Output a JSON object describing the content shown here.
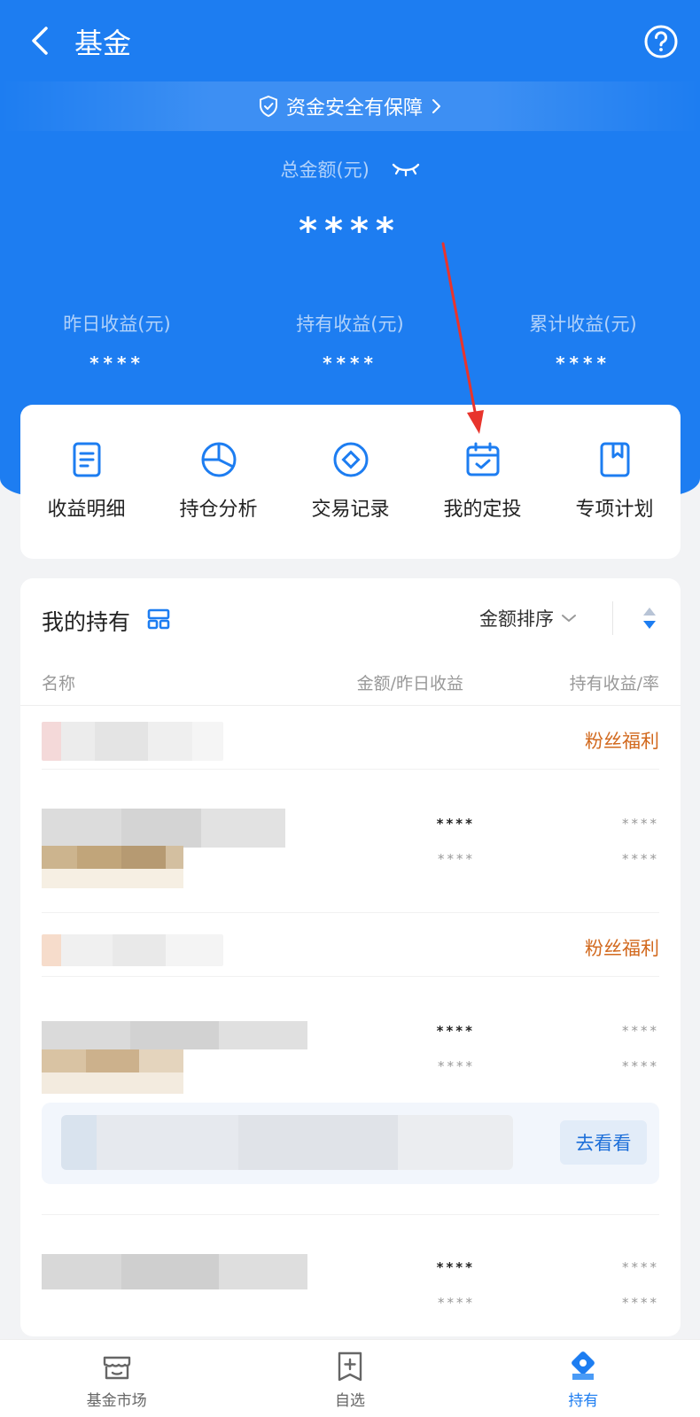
{
  "header": {
    "title": "基金",
    "back_icon": "chevron-left-icon",
    "help_icon": "question-circle-icon"
  },
  "security_banner": {
    "text": "资金安全有保障"
  },
  "summary": {
    "total_label": "总金额(元)",
    "total_value": "****",
    "stats": [
      {
        "label": "昨日收益(元)",
        "value": "****"
      },
      {
        "label": "持有收益(元)",
        "value": "****"
      },
      {
        "label": "累计收益(元)",
        "value": "****"
      }
    ]
  },
  "shortcuts": [
    {
      "label": "收益明细",
      "icon": "document-icon"
    },
    {
      "label": "持仓分析",
      "icon": "pie-chart-icon"
    },
    {
      "label": "交易记录",
      "icon": "coin-icon"
    },
    {
      "label": "我的定投",
      "icon": "calendar-check-icon"
    },
    {
      "label": "专项计划",
      "icon": "bookmark-book-icon"
    }
  ],
  "holdings": {
    "title": "我的持有",
    "sort_label": "金额排序",
    "columns": {
      "name": "名称",
      "amount": "金额/昨日收益",
      "profit": "持有收益/率"
    },
    "groups": [
      {
        "tag": "粉丝福利",
        "rows": [
          {
            "amount": "****",
            "yesterday": "****",
            "profit": "****",
            "rate": "****"
          }
        ]
      },
      {
        "tag": "粉丝福利",
        "rows": [
          {
            "amount": "****",
            "yesterday": "****",
            "profit": "****",
            "rate": "****"
          }
        ],
        "promo_button": "去看看"
      },
      {
        "tag": "",
        "rows": [
          {
            "amount": "****",
            "yesterday": "****",
            "profit": "****",
            "rate": "****"
          }
        ]
      }
    ]
  },
  "tabbar": [
    {
      "label": "基金市场",
      "icon": "store-icon",
      "active": false
    },
    {
      "label": "自选",
      "icon": "add-bookmark-icon",
      "active": false
    },
    {
      "label": "持有",
      "icon": "holdings-icon",
      "active": true
    }
  ],
  "colors": {
    "primary": "#1d7df1",
    "tag": "#d2691e",
    "annotation_arrow": "#e8342c"
  }
}
